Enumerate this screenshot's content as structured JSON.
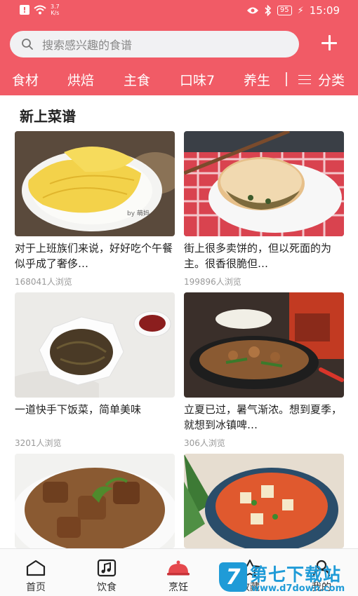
{
  "status_bar": {
    "signal_speed": "3.7",
    "speed_unit": "K/s",
    "battery": "95",
    "time": "15:09"
  },
  "search": {
    "placeholder": "搜索感兴趣的食谱"
  },
  "categories": [
    "食材",
    "烘焙",
    "主食",
    "口味7",
    "养生"
  ],
  "category_more": "分类",
  "section_title": "新上菜谱",
  "recipes": [
    {
      "title": "对于上班族们来说，好好吃个午餐似乎成了奢侈…",
      "views": "168041人浏览",
      "image_caption": "by 萌妈"
    },
    {
      "title": "街上很多卖饼的，但以死面的为主。很香很脆但…",
      "views": "199896人浏览"
    },
    {
      "title": "一道快手下饭菜，简单美味",
      "views": "3201人浏览"
    },
    {
      "title": "立夏已过，暑气渐浓。想到夏季，就想到冰镇啤…",
      "views": "306人浏览"
    }
  ],
  "bottom_nav": [
    "首页",
    "饮食",
    "烹饪",
    "收藏",
    "我的"
  ],
  "watermark": {
    "badge": "7",
    "title": "第七下载站",
    "url": "www.d7down.com"
  },
  "colors": {
    "brand": "#f15b66",
    "watermark": "#1f9bd7"
  }
}
